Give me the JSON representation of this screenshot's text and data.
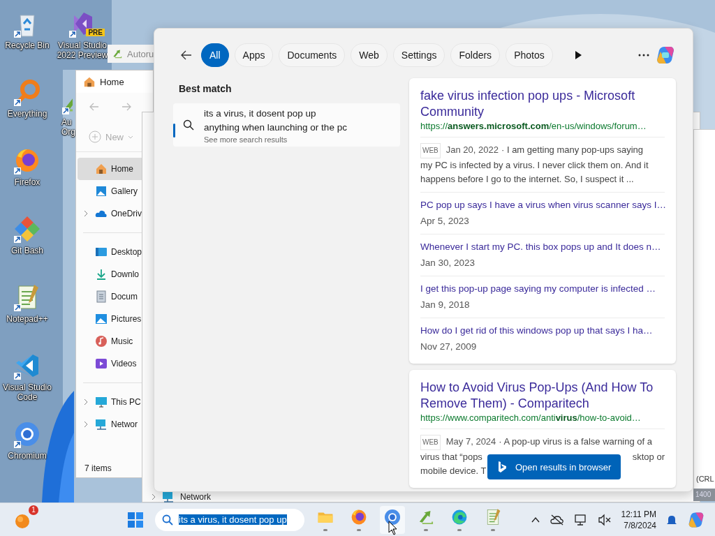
{
  "desktop_columns": [
    {
      "icons": [
        {
          "kind": "bin",
          "label": "Recycle Bin"
        },
        {
          "kind": "ring",
          "label": "Everything"
        },
        {
          "kind": "fox",
          "label": "Firefox"
        },
        {
          "kind": "diamond",
          "label": "Git Bash"
        },
        {
          "kind": "notepad",
          "label": "Notepad++"
        },
        {
          "kind": "vs",
          "label": "Visual Studio Code"
        },
        {
          "kind": "circle",
          "label": "Chromium"
        }
      ]
    },
    {
      "icons": [
        {
          "kind": "vspre",
          "label": "Visual Studio 2022 Preview",
          "badge": "PRE"
        },
        {
          "kind": "arrows",
          "label": "Au Org"
        }
      ]
    }
  ],
  "autoruns_window": {
    "title": "Autoru"
  },
  "explorer": {
    "tab": "Home",
    "new_button": "New",
    "nav_groups": [
      {
        "items": [
          {
            "kind": "home",
            "label": "Home",
            "selected": true,
            "expandable": false
          },
          {
            "kind": "gallery",
            "label": "Gallery",
            "selected": false,
            "expandable": false
          },
          {
            "kind": "cloud",
            "label": "OneDriv",
            "selected": false,
            "expandable": true
          }
        ]
      },
      {
        "items": [
          {
            "kind": "desktop",
            "label": "Desktop",
            "selected": false,
            "expandable": false
          },
          {
            "kind": "download",
            "label": "Downlo",
            "selected": false,
            "expandable": false
          },
          {
            "kind": "document",
            "label": "Docum",
            "selected": false,
            "expandable": false
          },
          {
            "kind": "pictures",
            "label": "Pictures",
            "selected": false,
            "expandable": false
          },
          {
            "kind": "music",
            "label": "Music",
            "selected": false,
            "expandable": false
          },
          {
            "kind": "videos",
            "label": "Videos",
            "selected": false,
            "expandable": false
          }
        ]
      },
      {
        "items": [
          {
            "kind": "pc",
            "label": "This PC",
            "selected": false,
            "expandable": true
          },
          {
            "kind": "network",
            "label": "Networ",
            "selected": false,
            "expandable": true
          }
        ]
      }
    ],
    "status": "7 items"
  },
  "back_window": {
    "nav_item": "Network"
  },
  "right_window": {
    "status": "(CRL",
    "counter": "1400"
  },
  "search_panel": {
    "tabs": [
      {
        "label": "All",
        "selected": true
      },
      {
        "label": "Apps",
        "selected": false
      },
      {
        "label": "Documents",
        "selected": false
      },
      {
        "label": "Web",
        "selected": false
      },
      {
        "label": "Settings",
        "selected": false
      },
      {
        "label": "Folders",
        "selected": false
      },
      {
        "label": "Photos",
        "selected": false
      }
    ],
    "best_match": {
      "heading": "Best match",
      "query_lines": [
        "its a virus, it dosent pop up",
        "anything when launching or the pc"
      ],
      "hint": "See more search results"
    },
    "results": [
      {
        "title": "fake virus infection pop ups - Microsoft Community",
        "url": "https://**answers.microsoft.com**/en-us/windows/forum…",
        "tag": "WEB",
        "date": "Jan 20, 2022",
        "snippet_lines": [
          [
            "· I am getting many pop-ups saying"
          ],
          [
            "my PC is infected by a virus. I never click them on. And it"
          ],
          [
            "happens before I go to the internet. So, I suspect it ..."
          ]
        ],
        "related": [
          {
            "title": "PC pop up says I have a virus when virus scanner says I…",
            "date": "Apr 5, 2023"
          },
          {
            "title": "Whenever I start my PC. this box pops up and It does n…",
            "date": "Jan 30, 2023"
          },
          {
            "title": "I get this pop-up page saying my computer is infected …",
            "date": "Jan 9, 2018"
          },
          {
            "title": "How do I get rid of this windows pop up that says I ha…",
            "date": "Nov 27, 2009"
          }
        ]
      },
      {
        "title": "How to Avoid Virus Pop-Ups (And How To Remove Them) - Comparitech",
        "url": "https://www.comparitech.com/anti**virus**/how-to-avoid…",
        "tag": "WEB",
        "date": "May 7, 2024",
        "snippet_lines": [
          [
            "· A pop-up virus is a false warning of a"
          ],
          [
            "virus that “pops",
            "sktop or"
          ],
          [
            "mobile device. T"
          ]
        ]
      }
    ],
    "open_button": "Open results in browser"
  },
  "taskbar": {
    "notification_count": "1",
    "search_text": "its a virus, it dosent pop up",
    "search_selected": true,
    "apps": [
      {
        "kind": "folder",
        "selected": false
      },
      {
        "kind": "fox",
        "selected": false
      },
      {
        "kind": "circle",
        "selected": true
      },
      {
        "kind": "arrows",
        "selected": false
      },
      {
        "kind": "edge",
        "selected": false
      },
      {
        "kind": "notepad",
        "selected": false
      }
    ],
    "time": "12:11 PM",
    "date": "7/8/2024"
  }
}
